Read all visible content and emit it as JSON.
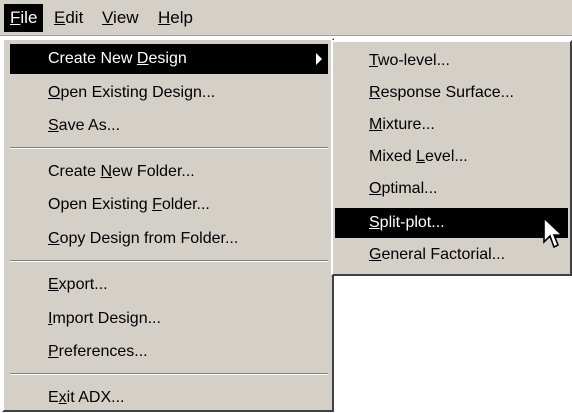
{
  "menubar": {
    "items": [
      {
        "pre": "",
        "ul": "F",
        "post": "ile"
      },
      {
        "pre": "",
        "ul": "E",
        "post": "dit"
      },
      {
        "pre": "",
        "ul": "V",
        "post": "iew"
      },
      {
        "pre": "",
        "ul": "H",
        "post": "elp"
      }
    ]
  },
  "file_menu": {
    "items": [
      {
        "pre": "Create New ",
        "ul": "D",
        "post": "esign"
      },
      {
        "pre": "",
        "ul": "O",
        "post": "pen Existing Design..."
      },
      {
        "pre": "",
        "ul": "S",
        "post": "ave As..."
      },
      {
        "pre": "Create ",
        "ul": "N",
        "post": "ew Folder..."
      },
      {
        "pre": "Open Existing ",
        "ul": "F",
        "post": "older..."
      },
      {
        "pre": "",
        "ul": "C",
        "post": "opy Design from Folder..."
      },
      {
        "pre": "",
        "ul": "E",
        "post": "xport..."
      },
      {
        "pre": "",
        "ul": "I",
        "post": "mport Design..."
      },
      {
        "pre": "",
        "ul": "P",
        "post": "references..."
      },
      {
        "pre": "E",
        "ul": "x",
        "post": "it ADX..."
      }
    ]
  },
  "submenu": {
    "items": [
      {
        "pre": "",
        "ul": "T",
        "post": "wo-level..."
      },
      {
        "pre": "",
        "ul": "R",
        "post": "esponse Surface..."
      },
      {
        "pre": "",
        "ul": "M",
        "post": "ixture..."
      },
      {
        "pre": "Mixed ",
        "ul": "L",
        "post": "evel..."
      },
      {
        "pre": "",
        "ul": "O",
        "post": "ptimal..."
      },
      {
        "pre": "",
        "ul": "S",
        "post": "plit-plot..."
      },
      {
        "pre": "",
        "ul": "G",
        "post": "eneral Factorial..."
      }
    ]
  },
  "icons": {
    "submenu_arrow": "arrow-right-icon",
    "cursor": "mouse-pointer-icon"
  },
  "colors": {
    "menu_background": "#d4d0c8",
    "highlight": "#000000",
    "highlight_text": "#ffffff"
  }
}
